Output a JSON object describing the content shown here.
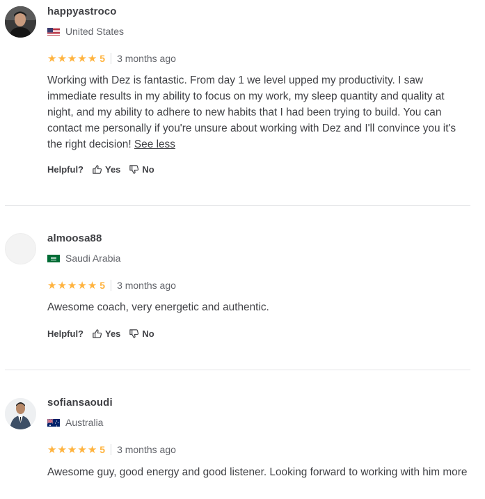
{
  "reviews": [
    {
      "username": "happyastroco",
      "country": "United States",
      "flag": "us-flag",
      "avatar": "user-photo-avatar",
      "rating": "5",
      "time": "3 months ago",
      "body": "Working with Dez is fantastic. From day 1 we level upped my productivity. I saw immediate results in my ability to focus on my work, my sleep quantity and quality at night, and my ability to adhere to new habits that I had been trying to build. You can contact me personally if you're unsure about working with Dez and I'll convince you it's the right decision!",
      "see_less": "See less",
      "helpful_label": "Helpful?",
      "yes_label": "Yes",
      "no_label": "No"
    },
    {
      "username": "almoosa88",
      "country": "Saudi Arabia",
      "flag": "saudi-flag",
      "avatar": "blank-avatar",
      "rating": "5",
      "time": "3 months ago",
      "body": "Awesome coach, very energetic and authentic.",
      "helpful_label": "Helpful?",
      "yes_label": "Yes",
      "no_label": "No"
    },
    {
      "username": "sofiansaoudi",
      "country": "Australia",
      "flag": "australia-flag",
      "avatar": "user-photo-avatar",
      "rating": "5",
      "time": "3 months ago",
      "body": "Awesome guy, good energy and good listener. Looking forward to working with him more"
    }
  ],
  "colors": {
    "star": "#ffb33e",
    "text": "#404145",
    "muted": "#62646a",
    "divider": "#e4e5e7"
  }
}
